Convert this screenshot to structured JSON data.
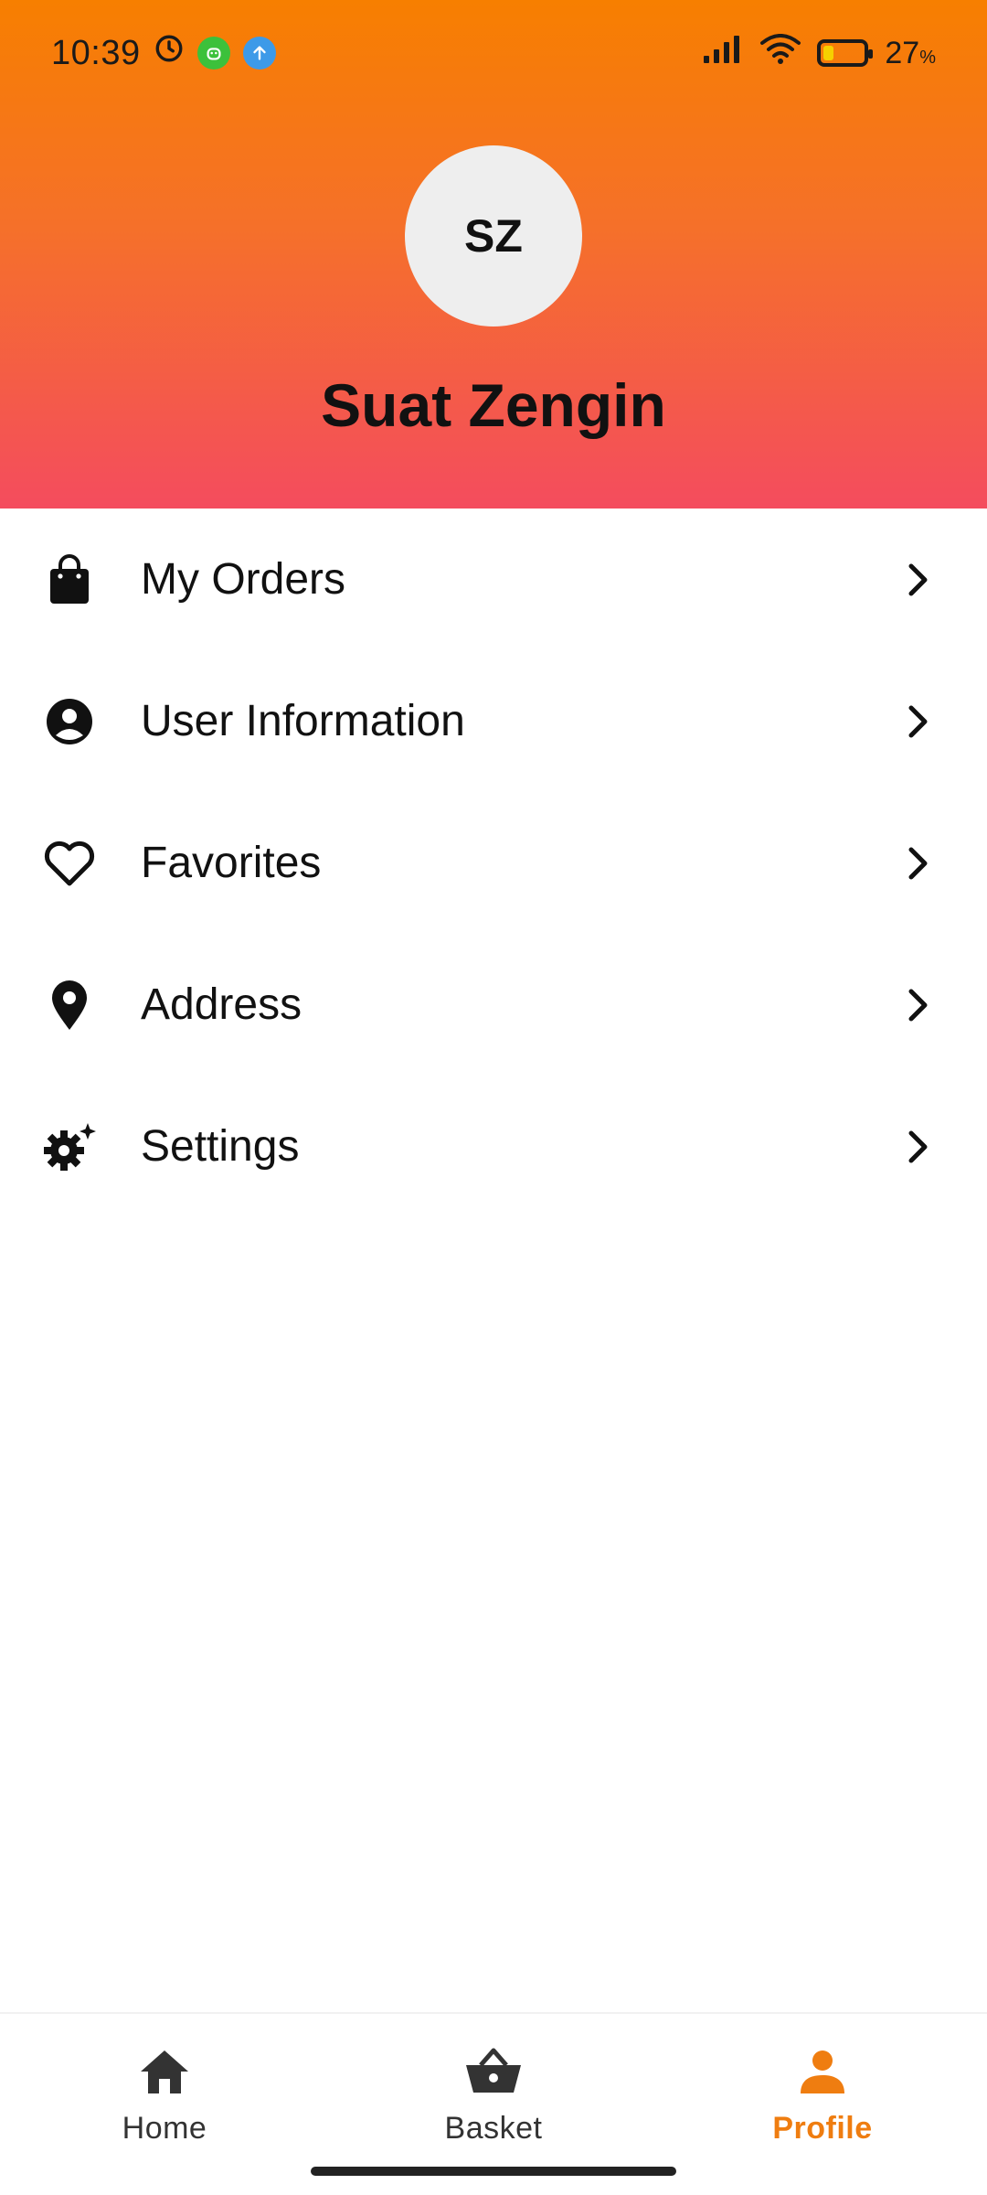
{
  "status_bar": {
    "time": "10:39",
    "battery_percent": "27",
    "battery_unit": "%",
    "battery_level": 0.27,
    "icons": [
      "alarm-icon",
      "android-notification-icon",
      "upload-notification-icon",
      "signal-icon",
      "wifi-icon",
      "battery-icon"
    ]
  },
  "profile": {
    "initials": "SZ",
    "name": "Suat Zengin"
  },
  "menu": {
    "items": [
      {
        "label": "My Orders",
        "icon": "shopping-bag-icon"
      },
      {
        "label": "User Information",
        "icon": "account-circle-icon"
      },
      {
        "label": "Favorites",
        "icon": "heart-outline-icon"
      },
      {
        "label": "Address",
        "icon": "location-pin-icon"
      },
      {
        "label": "Settings",
        "icon": "settings-gear-icon"
      }
    ]
  },
  "bottom_nav": {
    "items": [
      {
        "label": "Home",
        "icon": "home-icon",
        "active": false
      },
      {
        "label": "Basket",
        "icon": "basket-icon",
        "active": false
      },
      {
        "label": "Profile",
        "icon": "person-icon",
        "active": true
      }
    ]
  },
  "colors": {
    "header_top": "#f77f00",
    "header_bottom": "#f44c5e",
    "accent": "#ef7d10",
    "avatar_bg": "#eeeeee"
  }
}
